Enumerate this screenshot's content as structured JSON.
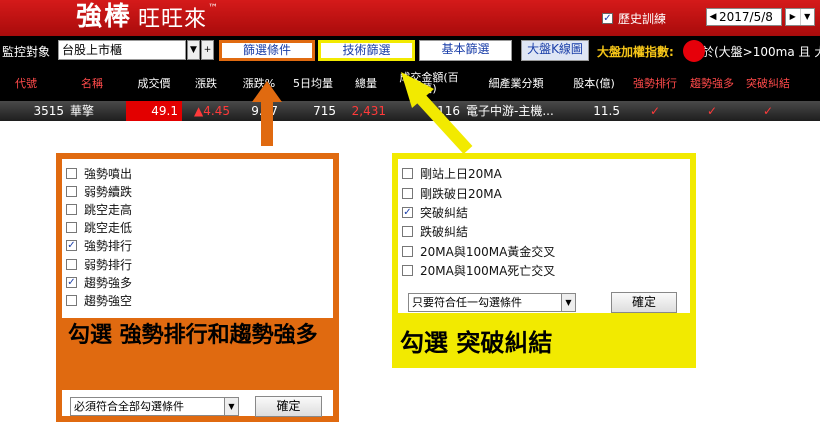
{
  "header": {
    "logo_bold": "強棒",
    "logo_rest": "旺旺來",
    "logo_tm": "™",
    "history_checked": "✓",
    "history_label": "歷史訓練",
    "date_value": "2017/5/8",
    "arrow_left": "◀",
    "arrow_right": "▶",
    "arrow_down": "▼"
  },
  "toolbar": {
    "monitor_label": "監控對象",
    "market_value": "台股上市櫃",
    "dropdown_glyph": "▼",
    "plus_glyph": "+",
    "btn_filter_conditions": "篩選條件",
    "btn_technical_filter": "技術篩選",
    "btn_fundamental_filter": "基本篩選",
    "btn_index_kline": "大盤K線圖",
    "index_weight_label": "大盤加權指數:",
    "index_condition": "於(大盤>100ma 且 大"
  },
  "table": {
    "headers": [
      "代號",
      "名稱",
      "成交價",
      "漲跌",
      "漲跌%",
      "5日均量",
      "總量",
      "成交金額(百萬)",
      "細產業分類",
      "股本(億)",
      "強勢排行",
      "趨勢強多",
      "突破糾結"
    ],
    "row": {
      "code": "3515",
      "name": "華擎",
      "price": "49.1",
      "change": "▲4.45",
      "change_pct": "9.97",
      "avg5": "715",
      "volume": "2,431",
      "amount": "116",
      "industry": "電子中游-主機...",
      "capital": "11.5",
      "strong_rank": "✓",
      "trend_strong": "✓",
      "breakout": "✓"
    }
  },
  "orange_panel": {
    "options": [
      {
        "label": "強勢噴出",
        "mark": ""
      },
      {
        "label": "弱勢續跌",
        "mark": ""
      },
      {
        "label": "跳空走高",
        "mark": ""
      },
      {
        "label": "跳空走低",
        "mark": ""
      },
      {
        "label": "強勢排行",
        "mark": "✓"
      },
      {
        "label": "弱勢排行",
        "mark": ""
      },
      {
        "label": "趨勢強多",
        "mark": "✓"
      },
      {
        "label": "趨勢強空",
        "mark": ""
      }
    ],
    "combo_value": "必須符合全部勾選條件",
    "confirm": "確定",
    "annotation": "勾選 強勢排行和趨勢強多"
  },
  "yellow_panel": {
    "options": [
      {
        "label": "剛站上日20MA",
        "mark": ""
      },
      {
        "label": "剛跌破日20MA",
        "mark": ""
      },
      {
        "label": "突破糾結",
        "mark": "✓"
      },
      {
        "label": "跌破糾結",
        "mark": ""
      },
      {
        "label": "20MA與100MA黃金交叉",
        "mark": ""
      },
      {
        "label": "20MA與100MA死亡交叉",
        "mark": ""
      }
    ],
    "combo_value": "只要符合任一勾選條件",
    "confirm": "確定",
    "annotation": "勾選 突破糾結"
  },
  "colors": {
    "header_red": "#c41212",
    "annotation_orange": "#e06a10",
    "annotation_yellow": "#f2ea00",
    "link_blue": "#1a3ea8",
    "price_red": "#e30000"
  },
  "icons": [
    "checkbox-checked-icon",
    "triangle-left-icon",
    "triangle-right-icon",
    "triangle-down-icon",
    "red-dot-icon",
    "check-mark-icon",
    "up-arrow-icon",
    "diagonal-arrow-icon"
  ]
}
